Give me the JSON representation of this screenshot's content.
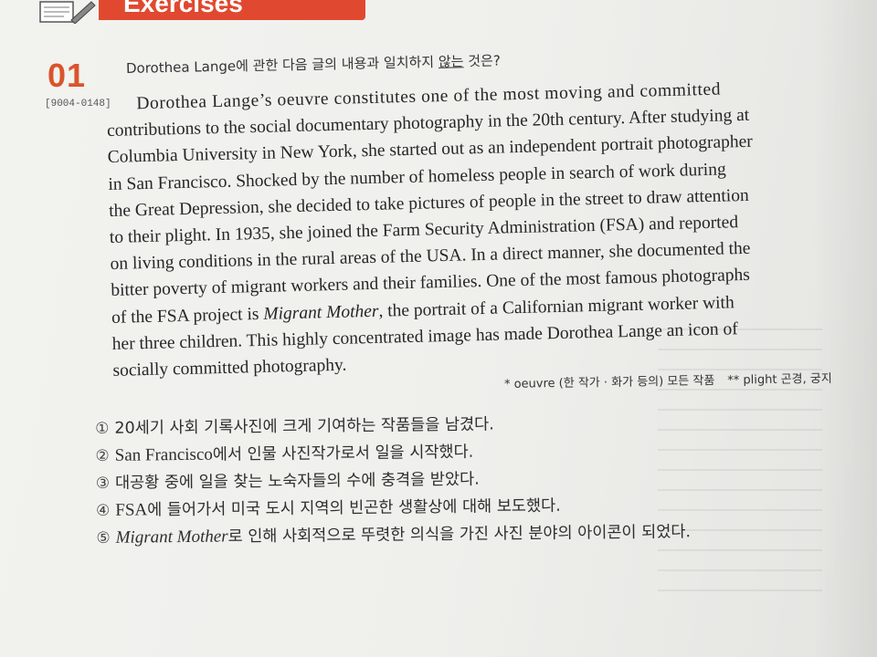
{
  "header": {
    "title": "Exercises"
  },
  "question": {
    "number": "01",
    "code": "[9004-0148]",
    "prompt_before": "Dorothea Lange에 관한 다음 글의 내용과 일치하지 ",
    "prompt_underlined": "않는",
    "prompt_after": " 것은?"
  },
  "passage": {
    "lines": [
      "Dorothea Lange’s oeuvre constitutes one of the most moving and committed",
      "contributions to the social documentary photography in the 20th century. After studying at",
      "Columbia University in New York, she started out as an independent portrait photographer",
      "in San Francisco. Shocked by the number of homeless people in search of work during",
      "the Great Depression, she decided to take pictures of people in the street to draw attention",
      "to their plight. In 1935, she joined the Farm Security Administration (FSA) and reported",
      "on living conditions in the rural areas of the USA. In a direct manner, she documented the",
      "bitter poverty of migrant workers and their families. One of the most famous photographs"
    ],
    "line9_before": "of the FSA project is ",
    "line9_italic": "Migrant Mother",
    "line9_after": ", the portrait of a Californian migrant worker with",
    "line10": "her three children. This highly concentrated image has made Dorothea Lange an icon of",
    "line11": "socially committed photography."
  },
  "footnote": {
    "note1": "* oeuvre (한 작가 · 화가 등의) 모든 작품",
    "note2": "** plight 곤경, 궁지"
  },
  "options": [
    {
      "mark": "①",
      "text": "20세기 사회 기록사진에 크게 기여하는 작품들을 남겼다."
    },
    {
      "mark": "②",
      "en": "San Francisco",
      "text": "에서 인물 사진작가로서 일을 시작했다."
    },
    {
      "mark": "③",
      "text": "대공황 중에 일을 찾는 노숙자들의 수에 충격을 받았다."
    },
    {
      "mark": "④",
      "en": "FSA",
      "text": "에 들어가서 미국 도시 지역의 빈곤한 생활상에 대해 보도했다."
    },
    {
      "mark": "⑤",
      "en_italic": "Migrant Mother",
      "text": "로 인해 사회적으로 뚜렷한 의식을 가진 사진 분야의 아이콘이 되었다."
    }
  ],
  "colors": {
    "accent": "#e0492f",
    "number": "#d9542d"
  },
  "icons": {
    "header": "pencil-notepad-icon"
  }
}
